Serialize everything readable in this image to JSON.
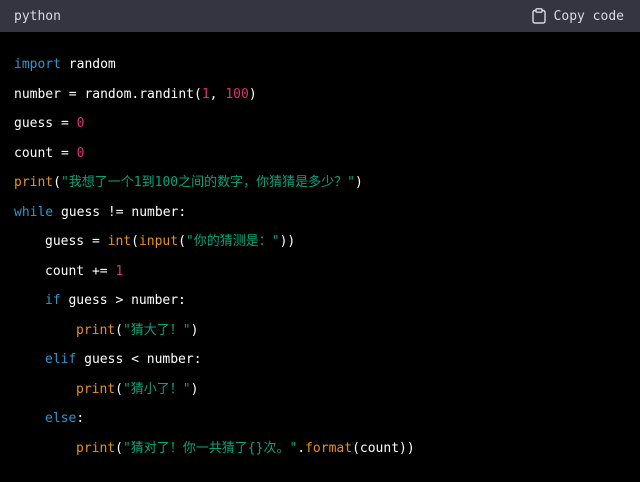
{
  "header": {
    "language": "python",
    "copy_label": "Copy code",
    "copy_icon": "clipboard-icon"
  },
  "colors": {
    "background": "#000000",
    "header_bg": "#343541",
    "plain": "#ffffff",
    "keyword": "#2e95d3",
    "builtin": "#e9950c",
    "number": "#df3079",
    "string": "#00a67d"
  },
  "code": {
    "lines": [
      {
        "indent": 0,
        "tokens": [
          {
            "t": "import",
            "c": "keyword"
          },
          {
            "t": " random",
            "c": "plain"
          }
        ]
      },
      {
        "indent": 0,
        "tokens": [
          {
            "t": "number = random.randint(",
            "c": "plain"
          },
          {
            "t": "1",
            "c": "number"
          },
          {
            "t": ", ",
            "c": "plain"
          },
          {
            "t": "100",
            "c": "number"
          },
          {
            "t": ")",
            "c": "plain"
          }
        ]
      },
      {
        "indent": 0,
        "tokens": [
          {
            "t": "guess = ",
            "c": "plain"
          },
          {
            "t": "0",
            "c": "number"
          }
        ]
      },
      {
        "indent": 0,
        "tokens": [
          {
            "t": "count = ",
            "c": "plain"
          },
          {
            "t": "0",
            "c": "number"
          }
        ]
      },
      {
        "indent": 0,
        "tokens": [
          {
            "t": "print",
            "c": "builtin"
          },
          {
            "t": "(",
            "c": "plain"
          },
          {
            "t": "\"我想了一个1到100之间的数字，你猜猜是多少？\"",
            "c": "string"
          },
          {
            "t": ")",
            "c": "plain"
          }
        ]
      },
      {
        "indent": 0,
        "tokens": [
          {
            "t": "while",
            "c": "keyword"
          },
          {
            "t": " guess != number:",
            "c": "plain"
          }
        ]
      },
      {
        "indent": 1,
        "tokens": [
          {
            "t": "guess = ",
            "c": "plain"
          },
          {
            "t": "int",
            "c": "builtin"
          },
          {
            "t": "(",
            "c": "plain"
          },
          {
            "t": "input",
            "c": "builtin"
          },
          {
            "t": "(",
            "c": "plain"
          },
          {
            "t": "\"你的猜测是：\"",
            "c": "string"
          },
          {
            "t": "))",
            "c": "plain"
          }
        ]
      },
      {
        "indent": 1,
        "tokens": [
          {
            "t": "count += ",
            "c": "plain"
          },
          {
            "t": "1",
            "c": "number"
          }
        ]
      },
      {
        "indent": 1,
        "tokens": [
          {
            "t": "if",
            "c": "keyword"
          },
          {
            "t": " guess > number:",
            "c": "plain"
          }
        ]
      },
      {
        "indent": 2,
        "tokens": [
          {
            "t": "print",
            "c": "builtin"
          },
          {
            "t": "(",
            "c": "plain"
          },
          {
            "t": "\"猜大了！\"",
            "c": "string"
          },
          {
            "t": ")",
            "c": "plain"
          }
        ]
      },
      {
        "indent": 1,
        "tokens": [
          {
            "t": "elif",
            "c": "keyword"
          },
          {
            "t": " guess < number:",
            "c": "plain"
          }
        ]
      },
      {
        "indent": 2,
        "tokens": [
          {
            "t": "print",
            "c": "builtin"
          },
          {
            "t": "(",
            "c": "plain"
          },
          {
            "t": "\"猜小了！\"",
            "c": "string"
          },
          {
            "t": ")",
            "c": "plain"
          }
        ]
      },
      {
        "indent": 1,
        "tokens": [
          {
            "t": "else",
            "c": "keyword"
          },
          {
            "t": ":",
            "c": "plain"
          }
        ]
      },
      {
        "indent": 2,
        "tokens": [
          {
            "t": "print",
            "c": "builtin"
          },
          {
            "t": "(",
            "c": "plain"
          },
          {
            "t": "\"猜对了！你一共猜了{}次。\"",
            "c": "string"
          },
          {
            "t": ".",
            "c": "plain"
          },
          {
            "t": "format",
            "c": "builtin"
          },
          {
            "t": "(count))",
            "c": "plain"
          }
        ]
      }
    ]
  }
}
